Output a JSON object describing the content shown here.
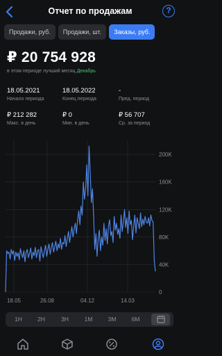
{
  "header": {
    "title": "Отчет по продажам",
    "help_label": "?"
  },
  "tabs": [
    {
      "label": "Продажи, руб.",
      "active": false
    },
    {
      "label": "Продажи, шт.",
      "active": false
    },
    {
      "label": "Заказы, руб.",
      "active": true
    }
  ],
  "summary": {
    "total": "₽ 20 754 928",
    "best_text": "в этом периоде лучший месяц",
    "best_month": "Декабрь"
  },
  "stats": {
    "start": {
      "value": "18.05.2021",
      "label": "Начало периода"
    },
    "end": {
      "value": "18.05.2022",
      "label": "Конец периода"
    },
    "prev": {
      "value": "-",
      "label": "Пред. период"
    },
    "max": {
      "value": "₽ 212 282",
      "label": "Макс. в день"
    },
    "min": {
      "value": "₽ 0",
      "label": "Мин. в день"
    },
    "avg": {
      "value": "₽ 56 707",
      "label": "Ср. за период"
    }
  },
  "ranges": [
    {
      "label": "1Н",
      "active": false
    },
    {
      "label": "2Н",
      "active": false
    },
    {
      "label": "3Н",
      "active": false
    },
    {
      "label": "1М",
      "active": false
    },
    {
      "label": "3М",
      "active": false
    },
    {
      "label": "6М",
      "active": false
    },
    {
      "label": "",
      "icon": "calendar-icon",
      "active": true
    }
  ],
  "bottom_nav": [
    {
      "icon": "home-icon",
      "active": false
    },
    {
      "icon": "box-icon",
      "active": false
    },
    {
      "icon": "percent-icon",
      "active": false
    },
    {
      "icon": "profile-icon",
      "active": true
    }
  ],
  "colors": {
    "accent": "#3b7cf5",
    "line": "#4f86e6",
    "positive": "#4cc16a",
    "background": "#111214"
  },
  "chart_data": {
    "type": "line",
    "x_tick_labels": [
      "18.05",
      "26.08",
      "04.12",
      "14.03"
    ],
    "y_tick_labels": [
      "0",
      "40K",
      "80K",
      "120K",
      "160K",
      "200K"
    ],
    "ylim": [
      0,
      212282
    ],
    "series": [
      {
        "x_labels": [
          "18.05",
          "26.08",
          "04.12",
          "14.03",
          "18.05"
        ],
        "values": [
          0,
          60000,
          56000,
          58000,
          48000,
          62000,
          55000,
          60000,
          46000,
          58000,
          52000,
          57000,
          47000,
          63000,
          55000,
          50000,
          60000,
          44000,
          58000,
          62000,
          50000,
          56000,
          64000,
          48000,
          58000,
          53000,
          65000,
          50000,
          60000,
          62000,
          45000,
          66000,
          57000,
          50000,
          60000,
          68000,
          52000,
          62000,
          70000,
          55000,
          65000,
          72000,
          58000,
          66000,
          74000,
          60000,
          70000,
          64000,
          78000,
          62000,
          72000,
          70000,
          82000,
          66000,
          78000,
          88000,
          72000,
          84000,
          95000,
          80000,
          92000,
          100000,
          85000,
          105000,
          118000,
          98000,
          125000,
          112000,
          160000,
          135000,
          150000,
          185000,
          140000,
          212282,
          175000,
          130000,
          150000,
          110000,
          62000,
          85000,
          52000,
          78000,
          90000,
          60000,
          80000,
          68000,
          100000,
          75000,
          92000,
          70000,
          96000,
          105000,
          82000,
          88000,
          72000,
          110000,
          90000,
          100000,
          84000,
          92000,
          78000,
          112000,
          88000,
          102000,
          120000,
          94000,
          108000,
          85000,
          118000,
          98000,
          104000,
          76000,
          95000,
          112000,
          86000,
          108000,
          100000,
          92000,
          115000,
          95000,
          106000,
          98000,
          110000,
          102000,
          100000,
          108000,
          96000,
          112000,
          104000,
          102000,
          45000,
          30000
        ]
      }
    ],
    "grid": true,
    "legend": "none"
  }
}
